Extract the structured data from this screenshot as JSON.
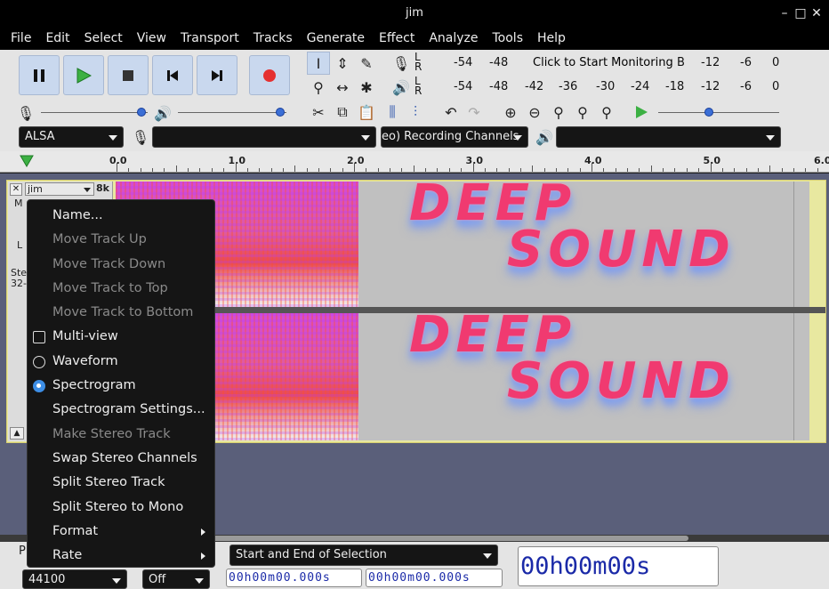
{
  "window": {
    "title": "jim",
    "minimize": "–",
    "maximize": "□",
    "close": "✕"
  },
  "menubar": [
    "File",
    "Edit",
    "Select",
    "View",
    "Transport",
    "Tracks",
    "Generate",
    "Effect",
    "Analyze",
    "Tools",
    "Help"
  ],
  "meters": {
    "record_lr": "L\nR",
    "play_lr": "L\nR",
    "record_ticks": [
      "-54",
      "-48"
    ],
    "monitor_prompt": "Click to Start Monitoring",
    "record_ticks_right": [
      "B",
      "-12",
      "-6",
      "0"
    ],
    "play_ticks": [
      "-54",
      "-48",
      "-42",
      "-36",
      "-30",
      "-24",
      "-18",
      "-12",
      "-6",
      "0"
    ]
  },
  "sliders": {
    "record_volume": 1.0,
    "playback_volume": 1.0,
    "play_speed": 0.42
  },
  "devices": {
    "host": "ALSA",
    "recording_device": "",
    "recording_channels": "eo) Recording Channels",
    "playback_device": ""
  },
  "ruler": {
    "ticks": [
      "0.0",
      "1.0",
      "2.0",
      "3.0",
      "4.0",
      "5.0",
      "6.0"
    ]
  },
  "track": {
    "name": "jim",
    "rate_badge": "8k",
    "info_line1": "Ste",
    "info_line2": "32-",
    "m_label": "M",
    "l_label": "L",
    "collapse": "▲"
  },
  "spectrogram": {
    "text_top_line1": "DEEP",
    "text_top_line2": "SOUND",
    "text_bottom_line1": "DEEP",
    "text_bottom_line2": "SOUND"
  },
  "context_menu": {
    "items": [
      {
        "label": "Name...",
        "enabled": true,
        "marker": "none",
        "submenu": false
      },
      {
        "label": "Move Track Up",
        "enabled": false,
        "marker": "none",
        "submenu": false
      },
      {
        "label": "Move Track Down",
        "enabled": false,
        "marker": "none",
        "submenu": false
      },
      {
        "label": "Move Track to Top",
        "enabled": false,
        "marker": "none",
        "submenu": false
      },
      {
        "label": "Move Track to Bottom",
        "enabled": false,
        "marker": "none",
        "submenu": false
      },
      {
        "label": "Multi-view",
        "enabled": true,
        "marker": "checkbox",
        "submenu": false
      },
      {
        "label": "Waveform",
        "enabled": true,
        "marker": "radio",
        "submenu": false
      },
      {
        "label": "Spectrogram",
        "enabled": true,
        "marker": "radio-on",
        "submenu": false
      },
      {
        "label": "Spectrogram Settings...",
        "enabled": true,
        "marker": "none",
        "submenu": false
      },
      {
        "label": "Make Stereo Track",
        "enabled": false,
        "marker": "none",
        "submenu": false
      },
      {
        "label": "Swap Stereo Channels",
        "enabled": true,
        "marker": "none",
        "submenu": false
      },
      {
        "label": "Split Stereo Track",
        "enabled": true,
        "marker": "none",
        "submenu": false
      },
      {
        "label": "Split Stereo to Mono",
        "enabled": true,
        "marker": "none",
        "submenu": false
      },
      {
        "label": "Format",
        "enabled": true,
        "marker": "none",
        "submenu": true
      },
      {
        "label": "Rate",
        "enabled": true,
        "marker": "none",
        "submenu": true
      }
    ]
  },
  "bottom": {
    "project_rate_label": "P",
    "project_rate": "44100",
    "snap": "Off",
    "selection_mode": "Start and End of Selection",
    "sel_start": "00h00m00.000s",
    "sel_end": "00h00m00.000s",
    "audio_position": "00h00m00s"
  },
  "colors": {
    "accent": "#3b6fd6",
    "spectro_text": "#f03a70",
    "track_bg": "#e8e8a0"
  }
}
